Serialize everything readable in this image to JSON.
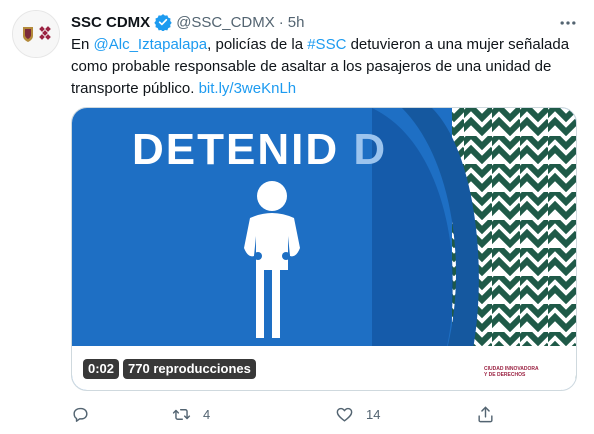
{
  "tweet": {
    "author_name": "SSC CDMX",
    "handle": "@SSC_CDMX",
    "separator": "·",
    "time": "5h",
    "text_prefix": "En ",
    "mention": "@Alc_Iztapalapa",
    "text_middle": ", policías de la ",
    "hashtag": "#SSC",
    "text_body": " detuvieron a una mujer señalada como probable responsable de asaltar a los pasajeros de una unidad de transporte público. ",
    "url": "bit.ly/3weKnLh"
  },
  "media": {
    "headline": "DETENID",
    "headline_tail": "D",
    "duration": "0:02",
    "views": "770 reproducciones",
    "brand_colors": {
      "blue": "#1e6fc4",
      "dark_blue": "#0f4f99",
      "green": "#1f5a48",
      "maroon": "#9b2242"
    }
  },
  "actions": {
    "reply_count": "",
    "retweet_count": "4",
    "like_count": "14"
  },
  "colors": {
    "link": "#1d9bf0",
    "muted": "#536471",
    "verified": "#1d9bf0"
  }
}
